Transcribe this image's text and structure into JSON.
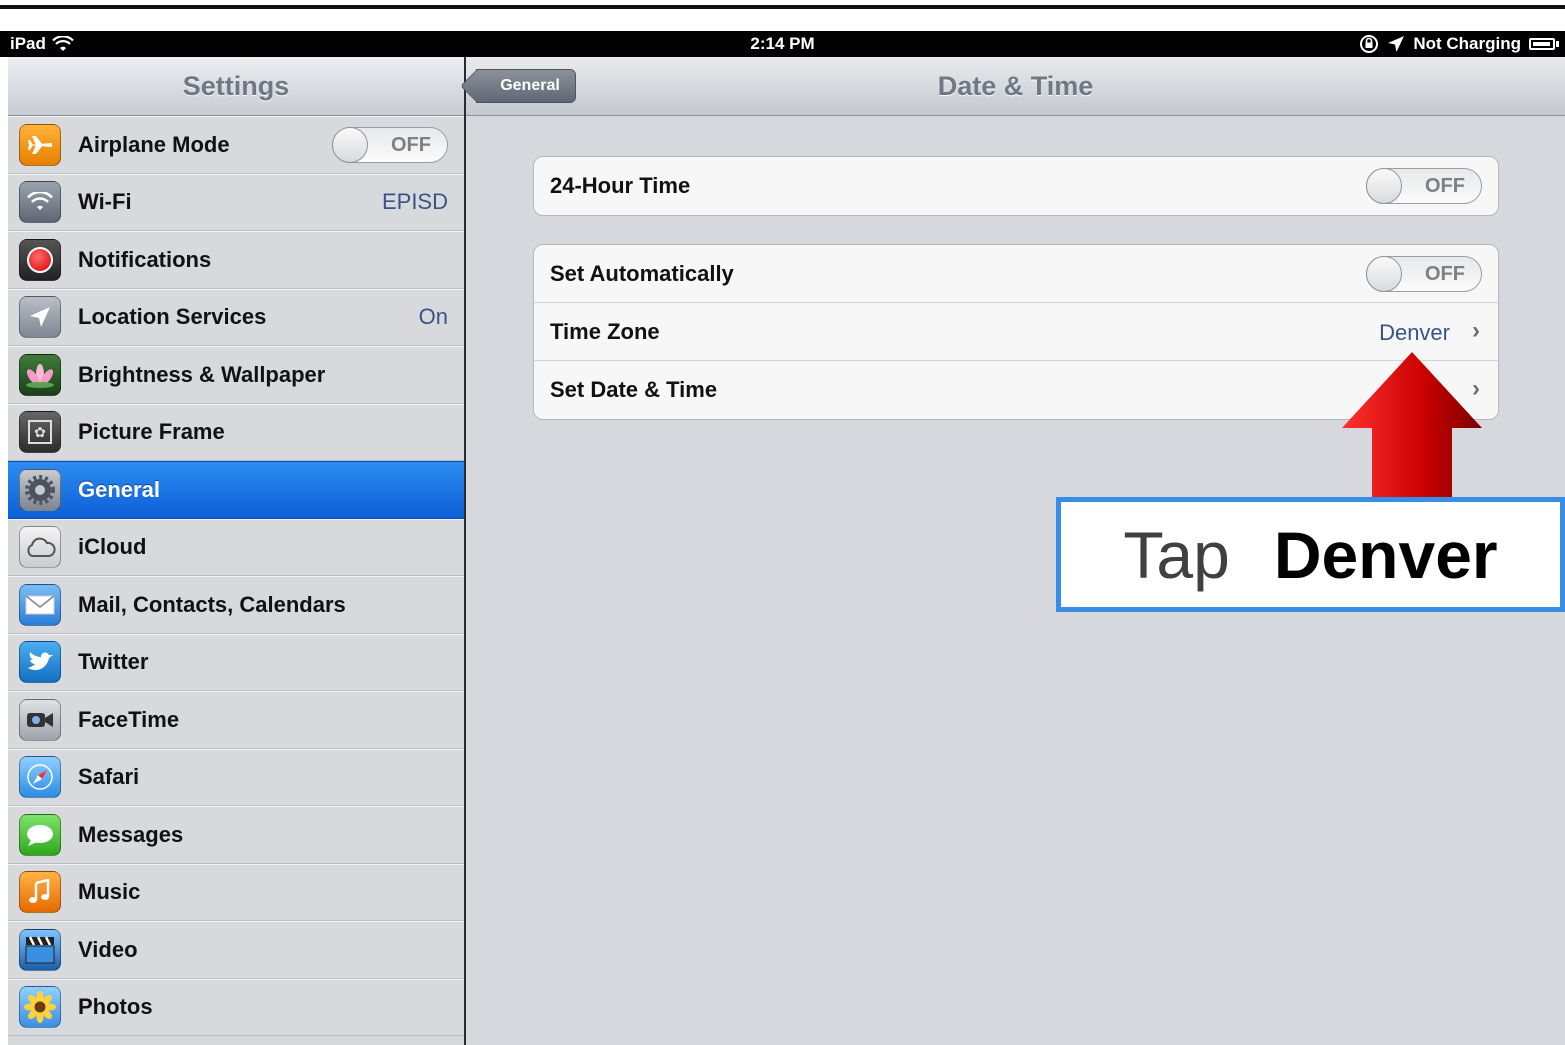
{
  "status_bar": {
    "device": "iPad",
    "time": "2:14 PM",
    "charge": "Not Charging"
  },
  "sidebar": {
    "title": "Settings",
    "items": [
      {
        "label": "Airplane Mode",
        "icon": "airplane-icon",
        "toggle": "OFF"
      },
      {
        "label": "Wi-Fi",
        "icon": "wifi-icon",
        "value": "EPISD"
      },
      {
        "label": "Notifications",
        "icon": "notifications-icon"
      },
      {
        "label": "Location Services",
        "icon": "location-icon",
        "value": "On"
      },
      {
        "label": "Brightness & Wallpaper",
        "icon": "flower-icon"
      },
      {
        "label": "Picture Frame",
        "icon": "picture-frame-icon"
      },
      {
        "label": "General",
        "icon": "gear-icon",
        "selected": true
      },
      {
        "label": "iCloud",
        "icon": "cloud-icon"
      },
      {
        "label": "Mail, Contacts, Calendars",
        "icon": "mail-icon"
      },
      {
        "label": "Twitter",
        "icon": "twitter-bird-icon"
      },
      {
        "label": "FaceTime",
        "icon": "camera-icon"
      },
      {
        "label": "Safari",
        "icon": "compass-icon"
      },
      {
        "label": "Messages",
        "icon": "speech-bubble-icon"
      },
      {
        "label": "Music",
        "icon": "music-note-icon"
      },
      {
        "label": "Video",
        "icon": "clapperboard-icon"
      },
      {
        "label": "Photos",
        "icon": "sunflower-icon"
      }
    ]
  },
  "nav": {
    "back_label": "General",
    "title": "Date & Time"
  },
  "groups": {
    "hour24": {
      "label": "24-Hour Time",
      "toggle": "OFF"
    },
    "set_automatically": {
      "label": "Set Automatically",
      "toggle": "OFF"
    },
    "time_zone": {
      "label": "Time Zone",
      "value": "Denver"
    },
    "set_date_time": {
      "label": "Set Date & Time"
    }
  },
  "annotation": {
    "verb": "Tap",
    "target": "Denver"
  },
  "colors": {
    "selection": "#1a74e6",
    "value_text": "#385487",
    "arrow": "#cc0000",
    "callout_border": "#3a8de6"
  }
}
